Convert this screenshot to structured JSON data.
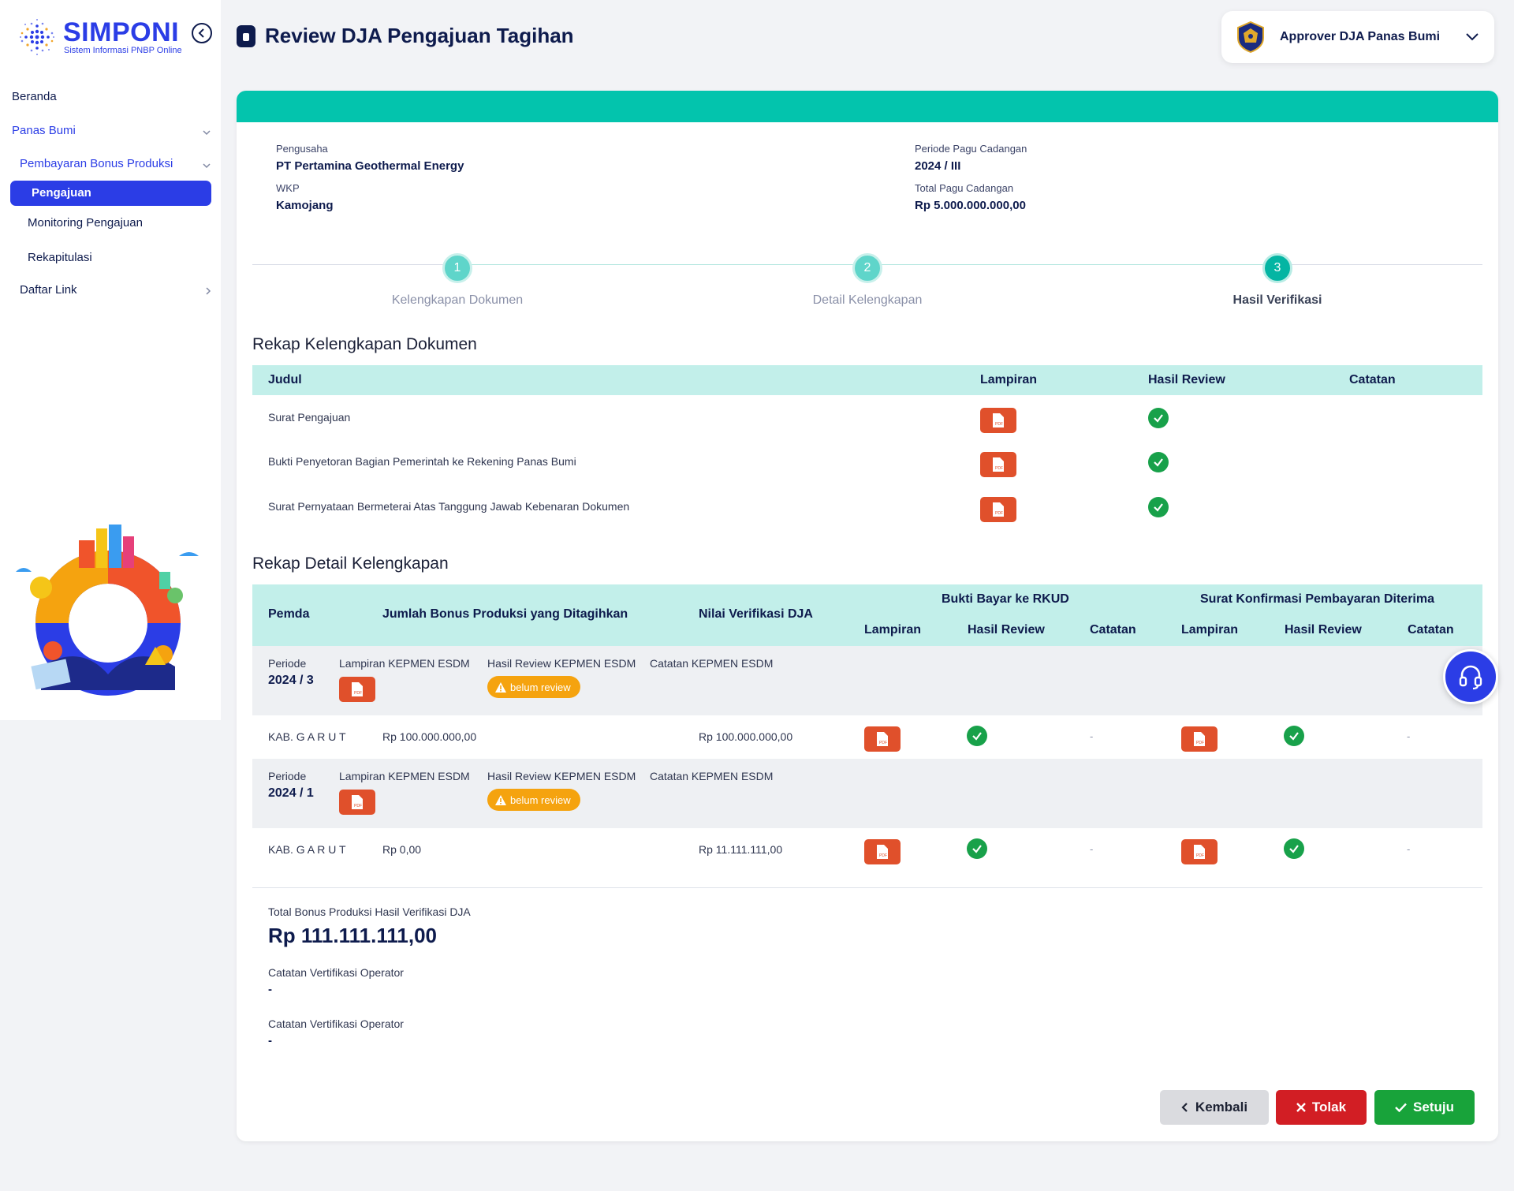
{
  "app": {
    "name": "SIMPONI",
    "subtitle": "Sistem Informasi PNBP Online"
  },
  "sidebar": {
    "items": [
      {
        "label": "Beranda"
      },
      {
        "label": "Panas Bumi"
      },
      {
        "label": "Pembayaran Bonus Produksi"
      },
      {
        "label": "Pengajuan"
      },
      {
        "label": "Monitoring Pengajuan"
      },
      {
        "label": "Rekapitulasi"
      },
      {
        "label": "Daftar Link"
      }
    ]
  },
  "header": {
    "title": "Review DJA Pengajuan Tagihan",
    "user": "Approver DJA Panas Bumi"
  },
  "info": {
    "pengusaha_label": "Pengusaha",
    "pengusaha_value": "PT Pertamina Geothermal Energy",
    "wkp_label": "WKP",
    "wkp_value": "Kamojang",
    "periode_label": "Periode Pagu Cadangan",
    "periode_value": "2024 / III",
    "total_label": "Total Pagu Cadangan",
    "total_value": "Rp 5.000.000.000,00"
  },
  "stepper": [
    {
      "num": "1",
      "label": "Kelengkapan Dokumen"
    },
    {
      "num": "2",
      "label": "Detail Kelengkapan"
    },
    {
      "num": "3",
      "label": "Hasil Verifikasi"
    }
  ],
  "rekap_dokumen": {
    "title": "Rekap Kelengkapan Dokumen",
    "headers": {
      "judul": "Judul",
      "lampiran": "Lampiran",
      "hasil": "Hasil Review",
      "catatan": "Catatan"
    },
    "rows": [
      {
        "judul": "Surat Pengajuan"
      },
      {
        "judul": "Bukti Penyetoran Bagian Pemerintah ke Rekening Panas Bumi"
      },
      {
        "judul": "Surat Pernyataan Bermeterai Atas Tanggung Jawab Kebenaran Dokumen"
      }
    ]
  },
  "rekap_detail": {
    "title": "Rekap Detail Kelengkapan",
    "headers": {
      "pemda": "Pemda",
      "jumlah": "Jumlah Bonus Produksi yang Ditagihkan",
      "nilai": "Nilai Verifikasi DJA",
      "bukti_group": "Bukti Bayar ke RKUD",
      "surat_group": "Surat Konfirmasi Pembayaran Diterima",
      "lampiran": "Lampiran",
      "hasil": "Hasil Review",
      "catatan": "Catatan"
    },
    "periode_labels": {
      "periode": "Periode",
      "lampiran": "Lampiran KEPMEN ESDM",
      "hasil": "Hasil Review KEPMEN ESDM",
      "catatan": "Catatan KEPMEN ESDM",
      "badge": "belum review"
    },
    "groups": [
      {
        "periode": "2024 / 3",
        "row": {
          "pemda": "KAB. G A R U T",
          "jumlah": "Rp 100.000.000,00",
          "nilai": "Rp 100.000.000,00",
          "bukti_catatan": "-",
          "surat_catatan": "-"
        }
      },
      {
        "periode": "2024 / 1",
        "row": {
          "pemda": "KAB. G A R U T",
          "jumlah": "Rp 0,00",
          "nilai": "Rp 11.111.111,00",
          "bukti_catatan": "-",
          "surat_catatan": "-"
        }
      }
    ]
  },
  "summary": {
    "total_label": "Total Bonus Produksi Hasil Verifikasi DJA",
    "total_value": "Rp 111.111.111,00",
    "notes": [
      {
        "label": "Catatan Vertifikasi Operator",
        "value": "-"
      },
      {
        "label": "Catatan Vertifikasi Operator",
        "value": "-"
      }
    ]
  },
  "actions": {
    "back": "Kembali",
    "reject": "Tolak",
    "approve": "Setuju"
  },
  "colors": {
    "primary": "#2b3de6",
    "teal": "#03c4ad",
    "success": "#18a14a",
    "danger": "#d21e24",
    "pdf": "#e0502b",
    "warning": "#f5a30f"
  }
}
